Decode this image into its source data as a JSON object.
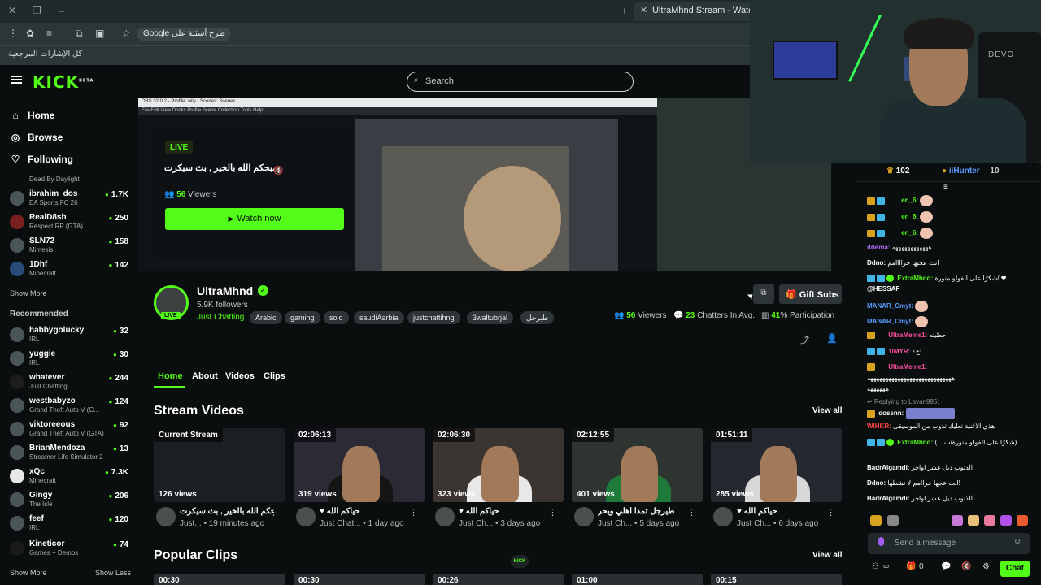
{
  "browser": {
    "tab_title": "UltraMhnd Stream - Watch Live",
    "omnibox": "Google طرح أسئلة على",
    "bookmarks": "كل الإشارات المرجعية"
  },
  "kick": {
    "logo": "KICK",
    "logo_sup": "BETA",
    "search_placeholder": "Search"
  },
  "nav": [
    {
      "label": "Home",
      "icon": "home-icon"
    },
    {
      "label": "Browse",
      "icon": "compass-icon"
    },
    {
      "label": "Following",
      "icon": "heart-icon"
    }
  ],
  "following": [
    {
      "name": "",
      "game": "Dead By Daylight",
      "viewers": ""
    },
    {
      "name": "ibrahim_dos",
      "game": "EA Sports FC 26",
      "viewers": "1.7K"
    },
    {
      "name": "RealD8sh",
      "game": "Respect RP (GTA)",
      "viewers": "250"
    },
    {
      "name": "SLN72",
      "game": "Mimesis",
      "viewers": "158"
    },
    {
      "name": "1Dhf",
      "game": "Minecraft",
      "viewers": "142"
    }
  ],
  "show_more": "Show More",
  "recommended_title": "Recommended",
  "recommended": [
    {
      "name": "habbygolucky",
      "game": "IRL",
      "viewers": "32"
    },
    {
      "name": "yuggie",
      "game": "IRL",
      "viewers": "30"
    },
    {
      "name": "whatever",
      "game": "Just Chatting",
      "viewers": "244"
    },
    {
      "name": "westbabyzo",
      "game": "Grand Theft Auto V (G...",
      "viewers": "124"
    },
    {
      "name": "viktoreeous",
      "game": "Grand Theft Auto V (GTA)",
      "viewers": "92"
    },
    {
      "name": "BrianMendoza",
      "game": "Streamer Life Simulator 2",
      "viewers": "13"
    },
    {
      "name": "xQc",
      "game": "Minecraft",
      "viewers": "7.3K"
    },
    {
      "name": "Gingy",
      "game": "The Isle",
      "viewers": "206"
    },
    {
      "name": "feef",
      "game": "IRL",
      "viewers": "120"
    },
    {
      "name": "Kineticor",
      "game": "Games + Demos",
      "viewers": "74"
    }
  ],
  "show_less": "Show Less",
  "player": {
    "obs_title": "OBS 32.0.2 - Profile: wily - Scenes: Scenes",
    "obs_menu": "File  Edit  View  Docks  Profile  Scene Collection  Tools  Help",
    "live": "LIVE",
    "title": "صبحكم الله بالخير , بث سيكرت",
    "viewers_count": "56",
    "viewers_label": "Viewers",
    "watch_now": "Watch now"
  },
  "cam": {
    "brand": "DEVO"
  },
  "channel": {
    "name": "UltraMhnd",
    "followers": "5.9K followers",
    "category": "Just Chatting",
    "tags": [
      "Arabic",
      "gaming",
      "solo",
      "saudiAarbia",
      "justchattihng",
      "3waltubrjal",
      "طيرجل"
    ],
    "live_badge": "LIVE",
    "gift_subs": "Gift Subs",
    "stat_viewers": "56",
    "stat_viewers_label": "Viewers",
    "stat_chatters": "23",
    "stat_chatters_label": "Chatters In Avg.",
    "stat_part": "41",
    "stat_part_label": "% Participation"
  },
  "tabs": [
    "Home",
    "About",
    "Videos",
    "Clips"
  ],
  "stream_videos": {
    "title": "Stream Videos",
    "view_all": "View all",
    "items": [
      {
        "badge": "Current Stream",
        "views": "126 views",
        "title": "صبحكم الله بالخير , بث سيكرت",
        "channel": "Just...",
        "ago": "19 minutes ago"
      },
      {
        "badge": "02:06:13",
        "views": "319 views",
        "title": "♥ حياكم الله",
        "channel": "Just Chat...",
        "ago": "1 day ago"
      },
      {
        "badge": "02:06:30",
        "views": "323 views",
        "title": "♥ حياكم الله",
        "channel": "Just Ch...",
        "ago": "3 days ago"
      },
      {
        "badge": "02:12:55",
        "views": "401 views",
        "title": "طيرجل تمذا اهلي ويحر",
        "channel": "Just Ch...",
        "ago": "5 days ago"
      },
      {
        "badge": "01:51:11",
        "views": "285 views",
        "title": "♥ حياكم الله",
        "channel": "Just Ch...",
        "ago": "6 days ago"
      }
    ]
  },
  "popular_clips": {
    "title": "Popular Clips",
    "view_all": "View all",
    "durations": [
      "00:30",
      "00:30",
      "00:26",
      "01:00",
      "00:15"
    ]
  },
  "chat": {
    "top_count1": "102",
    "top_user": "iiHunter",
    "top_count2": "10",
    "messages": [
      {
        "user": "en_6:",
        "text": "",
        "color": "#53fc18"
      },
      {
        "user": "en_6:",
        "text": "",
        "color": "#53fc18"
      },
      {
        "user": "en_6:",
        "text": "",
        "color": "#53fc18"
      },
      {
        "user": "itdema:",
        "text": "ههههههههههههه",
        "color": "#b36bff"
      },
      {
        "user": "Ddno:",
        "text": "انت عجبها حراااامم",
        "color": "#ffffff"
      },
      {
        "user": "ExtraMhnd:",
        "text": "شكرًا على الفولو منورة/ ❤",
        "color": "#53fc18"
      },
      {
        "user": "@HESSAF",
        "text": "",
        "color": "#ffffff"
      },
      {
        "user": "MANAR_Cmyt:",
        "text": "",
        "color": "#5b9bff"
      },
      {
        "user": "MANAR_Cmyt:",
        "text": "",
        "color": "#5b9bff"
      },
      {
        "user": "UltraMeme1:",
        "text": "حطيته",
        "color": "#ff4fa0"
      },
      {
        "user": "1IMYR:",
        "text": "ج؟!",
        "color": "#ff4fa0"
      },
      {
        "user": "UltraMeme1:",
        "text": "",
        "color": "#ff4fa0"
      },
      {
        "user": "",
        "text": "ههههههههههههههههههههههههههههه",
        "color": "#ffffff"
      },
      {
        "user": "",
        "text": "ههههههه",
        "color": "#ffffff"
      },
      {
        "user": "Replying to Lavan995:",
        "text": "",
        "color": "#8a9092"
      },
      {
        "user": "oossnn:",
        "text": "",
        "color": "#ffffff"
      },
      {
        "user": "WIHKR:",
        "text": "هذي الأغنية تعليك تذوب من الموسيقى",
        "color": "#ff4444"
      },
      {
        "user": "ExtraMhnd:",
        "text": "(... شكرًا على الفولو منورة/ب)",
        "color": "#53fc18"
      },
      {
        "user": "BadrAlgamdi:",
        "text": "الذنوب ديل عشر اواخر",
        "color": "#ffffff"
      },
      {
        "user": "Ddno:",
        "text": "انت عجها حراامم لا تشطها!",
        "color": "#ffffff"
      },
      {
        "user": "BadrAlgamdi:",
        "text": "الذنوب ديل عشر اواخر",
        "color": "#ffffff"
      }
    ],
    "input_placeholder": "Send a message",
    "points": "0",
    "send": "Chat"
  },
  "colors": {
    "accent": "#53fc18",
    "bg": "#0b0e0f"
  }
}
